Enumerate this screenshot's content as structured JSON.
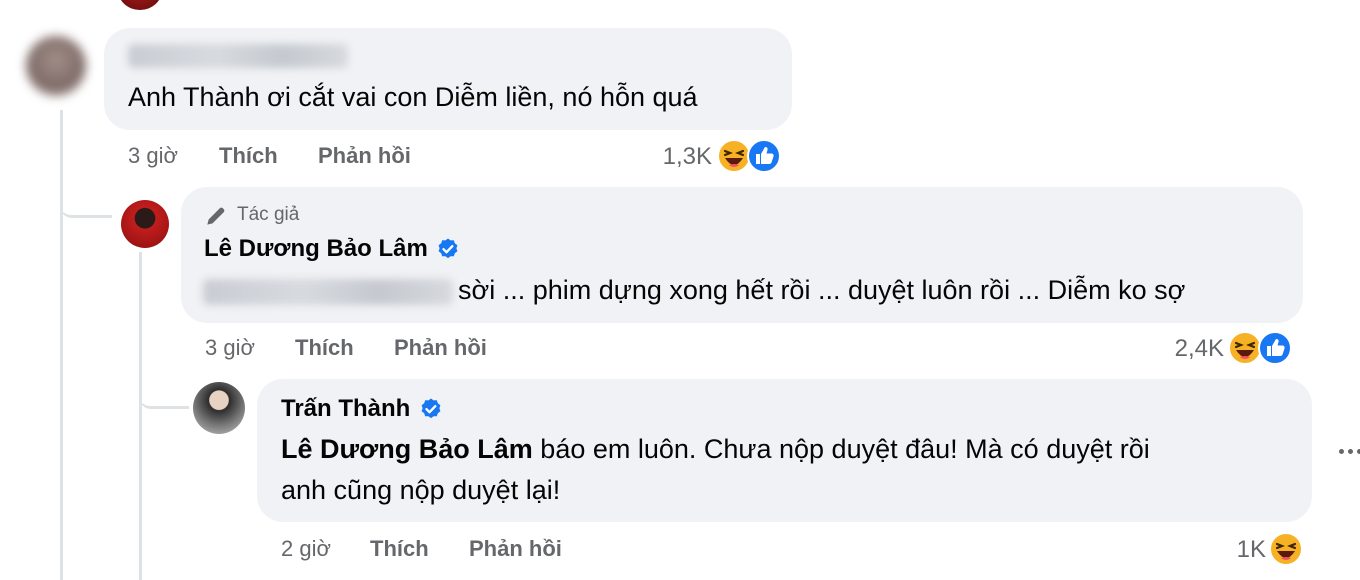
{
  "comments": [
    {
      "author_hidden": true,
      "text": "Anh Thành ơi cắt vai con Diễm liền, nó hỗn quá",
      "time": "3 giờ",
      "like_label": "Thích",
      "reply_label": "Phản hồi",
      "reaction_count": "1,3K",
      "reactions": [
        "haha-icon",
        "like-icon"
      ]
    },
    {
      "author_label": "Tác giả",
      "author": "Lê Dương Bảo Lâm",
      "verified": true,
      "text": "sời ... phim dựng xong hết rồi ... duyệt luôn rồi ... Diễm ko sợ",
      "time": "3 giờ",
      "like_label": "Thích",
      "reply_label": "Phản hồi",
      "reaction_count": "2,4K",
      "reactions": [
        "haha-icon",
        "like-icon"
      ]
    },
    {
      "author": "Trấn Thành",
      "verified": true,
      "mention": "Lê Dương Bảo Lâm",
      "text_line1": "báo em luôn. Chưa nộp duyệt đâu! Mà có duyệt rồi",
      "text_line2": "anh cũng nộp duyệt lại!",
      "time": "2 giờ",
      "like_label": "Thích",
      "reply_label": "Phản hồi",
      "reaction_count": "1K",
      "reactions": [
        "haha-icon"
      ]
    }
  ],
  "colors": {
    "bubble": "#f0f2f5",
    "meta_text": "#65676b",
    "like_blue": "#1877f2",
    "haha_yellow": "#f7b125"
  }
}
